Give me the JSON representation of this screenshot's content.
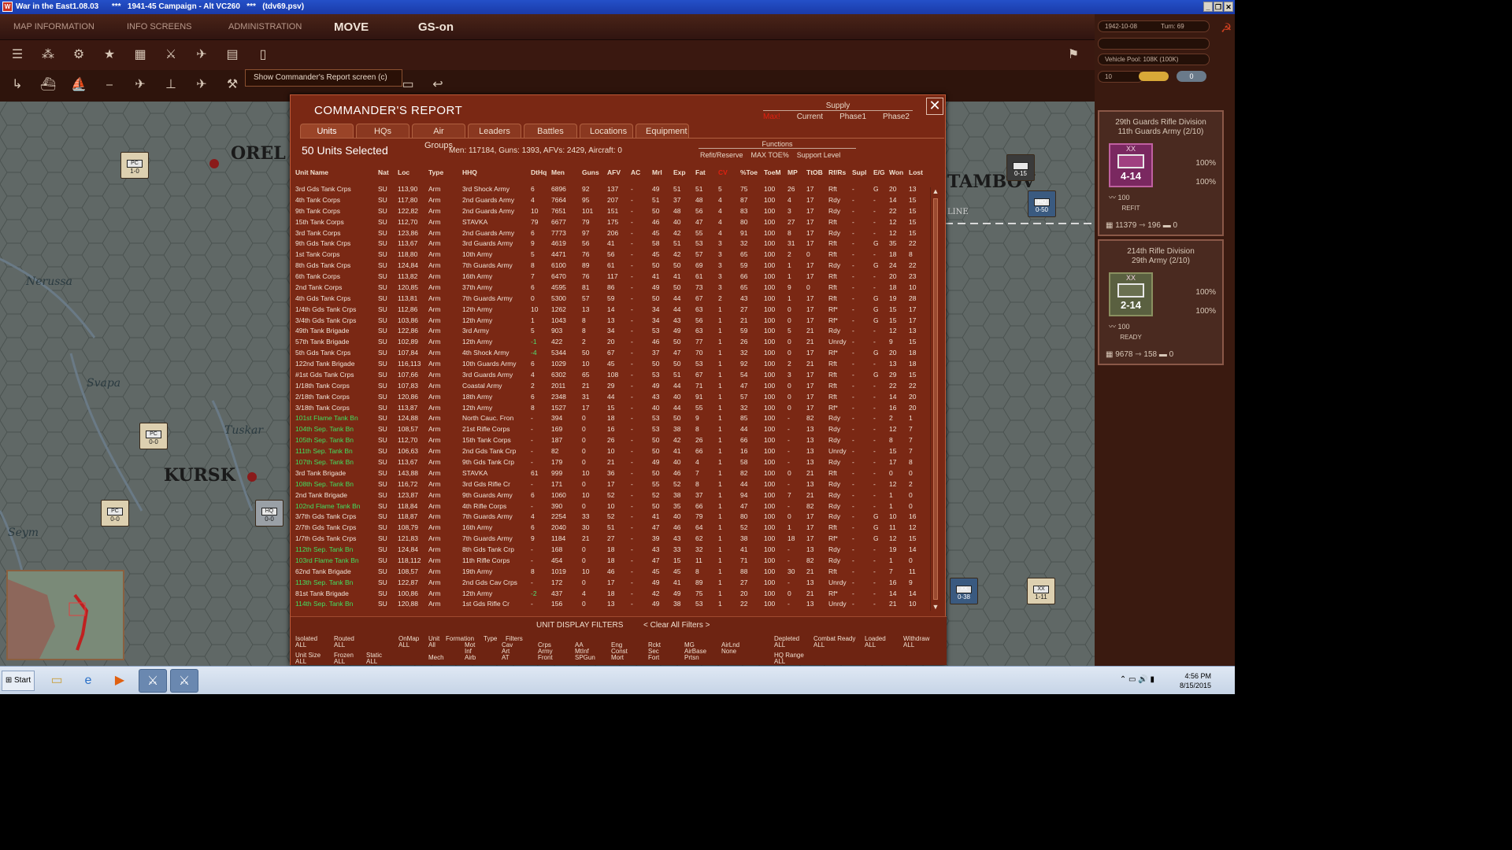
{
  "window": {
    "title": "War in the East1.08.03      ***   1941-45 Campaign - Alt VC260   ***   (tdv69.psv)"
  },
  "menu": {
    "map_information": "MAP INFORMATION",
    "info_screens": "INFO SCREENS",
    "administration": "ADMINISTRATION",
    "move": "MOVE",
    "gs": "GS-on"
  },
  "tooltip": "Show Commander's Report screen (c)",
  "status": {
    "date": "1942-10-08",
    "turn": "Turn: 69",
    "vehicle_pool": "Vehicle Pool: 108K (100K)",
    "count": "10",
    "zero": "0"
  },
  "map": {
    "city1": "OREL",
    "city2": "KURSK",
    "city3": "TAMBOV",
    "river1": "Nerussa",
    "river2": "Seym",
    "river3": "Tuskar",
    "river4": "Svapa",
    "line": "LINE"
  },
  "counters": [
    {
      "type": "PC",
      "val": "1-0"
    },
    {
      "type": "PC",
      "val": "0-0"
    },
    {
      "type": "PC",
      "val": "0-0"
    },
    {
      "type": "HQ",
      "val": "0-0"
    },
    {
      "type": "HQ",
      "val": "0-50"
    },
    {
      "type": "XX",
      "val": "0-38"
    },
    {
      "type": "XX",
      "val": "1-11"
    },
    {
      "type": "",
      "val": "0-15"
    }
  ],
  "cards": [
    {
      "name": "29th Guards Rifle Division",
      "sub": "11th Guards Army (2/10)",
      "str": "4-14",
      "xx": "XX",
      "pct1": "100%",
      "pct2": "100%",
      "morale": "100",
      "status": "REFIT",
      "men": "11379",
      "guns": "196",
      "afv": "0"
    },
    {
      "name": "214th Rifle Division",
      "sub": "29th Army (2/10)",
      "str": "2-14",
      "xx": "XX",
      "pct1": "100%",
      "pct2": "100%",
      "morale": "100",
      "status": "READY",
      "men": "9678",
      "guns": "158",
      "afv": "0"
    }
  ],
  "report": {
    "title": "COMMANDER'S REPORT",
    "supply_label": "Supply",
    "supply_opts": [
      "Max!",
      "Current",
      "Phase1",
      "Phase2"
    ],
    "tabs": [
      "Units",
      "HQs",
      "Air Groups",
      "Leaders",
      "Battles",
      "Locations",
      "Equipment"
    ],
    "selected": "50 Units Selected",
    "totals": "Men: 117184, Guns: 1393, AFVs: 2429, Aircraft: 0",
    "functions_label": "Functions",
    "functions": [
      "Refit/Reserve",
      "MAX TOE%",
      "Support Level"
    ],
    "columns": [
      "Unit Name",
      "Nat",
      "Loc",
      "Type",
      "HHQ",
      "DtHq",
      "Men",
      "Guns",
      "AFV",
      "AC",
      "Mrl",
      "Exp",
      "Fat",
      "CV",
      "%Toe",
      "ToeM",
      "MP",
      "TtOB",
      "Rf/Rs",
      "Supl",
      "E/G",
      "Won",
      "Lost"
    ],
    "rows": [
      [
        "3rd Gds Tank Crps",
        "SU",
        "113,90",
        "Arm",
        "3rd Shock Army",
        "6",
        "6896",
        "92",
        "137",
        "-",
        "49",
        "51",
        "51",
        "5",
        "75",
        "100",
        "26",
        "17",
        "Rft",
        "-",
        "G",
        "20",
        "13"
      ],
      [
        "4th Tank Corps",
        "SU",
        "117,80",
        "Arm",
        "2nd Guards Army",
        "4",
        "7664",
        "95",
        "207",
        "-",
        "51",
        "37",
        "48",
        "4",
        "87",
        "100",
        "4",
        "17",
        "Rdy",
        "-",
        "-",
        "14",
        "15"
      ],
      [
        "9th Tank Corps",
        "SU",
        "122,82",
        "Arm",
        "2nd Guards Army",
        "10",
        "7651",
        "101",
        "151",
        "-",
        "50",
        "48",
        "56",
        "4",
        "83",
        "100",
        "3",
        "17",
        "Rdy",
        "-",
        "-",
        "22",
        "15"
      ],
      [
        "15th Tank Corps",
        "SU",
        "112,70",
        "Arm",
        "STAVKA",
        "79",
        "6677",
        "79",
        "175",
        "-",
        "46",
        "40",
        "47",
        "4",
        "80",
        "100",
        "27",
        "17",
        "Rft",
        "-",
        "-",
        "12",
        "15"
      ],
      [
        "3rd Tank Corps",
        "SU",
        "123,86",
        "Arm",
        "2nd Guards Army",
        "6",
        "7773",
        "97",
        "206",
        "-",
        "45",
        "42",
        "55",
        "4",
        "91",
        "100",
        "8",
        "17",
        "Rdy",
        "-",
        "-",
        "12",
        "15"
      ],
      [
        "9th Gds Tank Crps",
        "SU",
        "113,67",
        "Arm",
        "3rd Guards Army",
        "9",
        "4619",
        "56",
        "41",
        "-",
        "58",
        "51",
        "53",
        "3",
        "32",
        "100",
        "31",
        "17",
        "Rft",
        "-",
        "G",
        "35",
        "22"
      ],
      [
        "1st Tank Corps",
        "SU",
        "118,80",
        "Arm",
        "10th Army",
        "5",
        "4471",
        "76",
        "56",
        "-",
        "45",
        "42",
        "57",
        "3",
        "65",
        "100",
        "2",
        "0",
        "Rft",
        "-",
        "-",
        "18",
        "8"
      ],
      [
        "8th Gds Tank Crps",
        "SU",
        "124,84",
        "Arm",
        "7th Guards Army",
        "8",
        "6100",
        "89",
        "61",
        "-",
        "50",
        "50",
        "69",
        "3",
        "59",
        "100",
        "1",
        "17",
        "Rdy",
        "-",
        "G",
        "24",
        "22"
      ],
      [
        "6th Tank Corps",
        "SU",
        "113,82",
        "Arm",
        "16th Army",
        "7",
        "6470",
        "76",
        "117",
        "-",
        "41",
        "41",
        "61",
        "3",
        "66",
        "100",
        "1",
        "17",
        "Rft",
        "-",
        "-",
        "20",
        "23"
      ],
      [
        "2nd Tank Corps",
        "SU",
        "120,85",
        "Arm",
        "37th Army",
        "6",
        "4595",
        "81",
        "86",
        "-",
        "49",
        "50",
        "73",
        "3",
        "65",
        "100",
        "9",
        "0",
        "Rft",
        "-",
        "-",
        "18",
        "10"
      ],
      [
        "4th Gds Tank Crps",
        "SU",
        "113,81",
        "Arm",
        "7th Guards Army",
        "0",
        "5300",
        "57",
        "59",
        "-",
        "50",
        "44",
        "67",
        "2",
        "43",
        "100",
        "1",
        "17",
        "Rft",
        "-",
        "G",
        "19",
        "28"
      ],
      [
        "1/4th Gds Tank Crps",
        "SU",
        "112,86",
        "Arm",
        "12th Army",
        "10",
        "1262",
        "13",
        "14",
        "-",
        "34",
        "44",
        "63",
        "1",
        "27",
        "100",
        "0",
        "17",
        "Rf*",
        "-",
        "G",
        "15",
        "17"
      ],
      [
        "3/4th Gds Tank Crps",
        "SU",
        "103,86",
        "Arm",
        "12th Army",
        "1",
        "1043",
        "8",
        "13",
        "-",
        "34",
        "43",
        "56",
        "1",
        "21",
        "100",
        "0",
        "17",
        "Rf*",
        "-",
        "G",
        "15",
        "17"
      ],
      [
        "49th Tank Brigade",
        "SU",
        "122,86",
        "Arm",
        "3rd Army",
        "5",
        "903",
        "8",
        "34",
        "-",
        "53",
        "49",
        "63",
        "1",
        "59",
        "100",
        "5",
        "21",
        "Rdy",
        "-",
        "-",
        "12",
        "13"
      ],
      [
        "57th Tank Brigade",
        "SU",
        "102,89",
        "Arm",
        "12th Army",
        "-1",
        "422",
        "2",
        "20",
        "-",
        "46",
        "50",
        "77",
        "1",
        "26",
        "100",
        "0",
        "21",
        "Unrdy",
        "-",
        "-",
        "9",
        "15"
      ],
      [
        "5th Gds Tank Crps",
        "SU",
        "107,84",
        "Arm",
        "4th Shock Army",
        "-4",
        "5344",
        "50",
        "67",
        "-",
        "37",
        "47",
        "70",
        "1",
        "32",
        "100",
        "0",
        "17",
        "Rf*",
        "-",
        "G",
        "20",
        "18"
      ],
      [
        "122nd Tank Brigade",
        "SU",
        "116,113",
        "Arm",
        "10th Guards Army",
        "6",
        "1029",
        "10",
        "45",
        "-",
        "50",
        "50",
        "53",
        "1",
        "92",
        "100",
        "2",
        "21",
        "Rft",
        "-",
        "-",
        "13",
        "18"
      ],
      [
        "#1st Gds Tank Crps",
        "SU",
        "107,66",
        "Arm",
        "3rd Guards Army",
        "4",
        "6302",
        "65",
        "108",
        "-",
        "53",
        "51",
        "67",
        "1",
        "54",
        "100",
        "3",
        "17",
        "Rft",
        "-",
        "G",
        "29",
        "15"
      ],
      [
        "1/18th Tank Corps",
        "SU",
        "107,83",
        "Arm",
        "Coastal Army",
        "2",
        "2011",
        "21",
        "29",
        "-",
        "49",
        "44",
        "71",
        "1",
        "47",
        "100",
        "0",
        "17",
        "Rft",
        "-",
        "-",
        "22",
        "22"
      ],
      [
        "2/18th Tank Corps",
        "SU",
        "120,86",
        "Arm",
        "18th Army",
        "6",
        "2348",
        "31",
        "44",
        "-",
        "43",
        "40",
        "91",
        "1",
        "57",
        "100",
        "0",
        "17",
        "Rft",
        "-",
        "-",
        "14",
        "20"
      ],
      [
        "3/18th Tank Corps",
        "SU",
        "113,87",
        "Arm",
        "12th Army",
        "8",
        "1527",
        "17",
        "15",
        "-",
        "40",
        "44",
        "55",
        "1",
        "32",
        "100",
        "0",
        "17",
        "Rf*",
        "-",
        "-",
        "16",
        "20"
      ],
      [
        "101st Flame Tank Bn",
        "SU",
        "124,88",
        "Arm",
        "North Cauc. Fron",
        "-",
        "394",
        "0",
        "18",
        "-",
        "53",
        "50",
        "9",
        "1",
        "85",
        "100",
        "-",
        "82",
        "Rdy",
        "-",
        "-",
        "2",
        "1"
      ],
      [
        "104th Sep. Tank Bn",
        "SU",
        "108,57",
        "Arm",
        "21st Rifle Corps",
        "-",
        "169",
        "0",
        "16",
        "-",
        "53",
        "38",
        "8",
        "1",
        "44",
        "100",
        "-",
        "13",
        "Rdy",
        "-",
        "-",
        "12",
        "7"
      ],
      [
        "105th Sep. Tank Bn",
        "SU",
        "112,70",
        "Arm",
        "15th Tank Corps",
        "-",
        "187",
        "0",
        "26",
        "-",
        "50",
        "42",
        "26",
        "1",
        "66",
        "100",
        "-",
        "13",
        "Rdy",
        "-",
        "-",
        "8",
        "7"
      ],
      [
        "111th Sep. Tank Bn",
        "SU",
        "106,63",
        "Arm",
        "2nd Gds Tank Crp",
        "-",
        "82",
        "0",
        "10",
        "-",
        "50",
        "41",
        "66",
        "1",
        "16",
        "100",
        "-",
        "13",
        "Unrdy",
        "-",
        "-",
        "15",
        "7"
      ],
      [
        "107th Sep. Tank Bn",
        "SU",
        "113,67",
        "Arm",
        "9th Gds Tank Crp",
        "-",
        "179",
        "0",
        "21",
        "-",
        "49",
        "40",
        "4",
        "1",
        "58",
        "100",
        "-",
        "13",
        "Rdy",
        "-",
        "-",
        "17",
        "8"
      ],
      [
        "3rd Tank Brigade",
        "SU",
        "143,88",
        "Arm",
        "STAVKA",
        "61",
        "999",
        "10",
        "36",
        "-",
        "50",
        "46",
        "7",
        "1",
        "82",
        "100",
        "0",
        "21",
        "Rft",
        "-",
        "-",
        "0",
        "0"
      ],
      [
        "108th Sep. Tank Bn",
        "SU",
        "116,72",
        "Arm",
        "3rd Gds Rifle Cr",
        "-",
        "171",
        "0",
        "17",
        "-",
        "55",
        "52",
        "8",
        "1",
        "44",
        "100",
        "-",
        "13",
        "Rdy",
        "-",
        "-",
        "12",
        "2"
      ],
      [
        "2nd Tank Brigade",
        "SU",
        "123,87",
        "Arm",
        "9th Guards Army",
        "6",
        "1060",
        "10",
        "52",
        "-",
        "52",
        "38",
        "37",
        "1",
        "94",
        "100",
        "7",
        "21",
        "Rdy",
        "-",
        "-",
        "1",
        "0"
      ],
      [
        "102nd Flame Tank Bn",
        "SU",
        "118,84",
        "Arm",
        "4th Rifle Corps",
        "-",
        "390",
        "0",
        "10",
        "-",
        "50",
        "35",
        "66",
        "1",
        "47",
        "100",
        "-",
        "82",
        "Rdy",
        "-",
        "-",
        "1",
        "0"
      ],
      [
        "3/7th Gds Tank Crps",
        "SU",
        "118,87",
        "Arm",
        "7th Guards Army",
        "4",
        "2254",
        "33",
        "52",
        "-",
        "41",
        "40",
        "79",
        "1",
        "80",
        "100",
        "0",
        "17",
        "Rdy",
        "-",
        "G",
        "10",
        "16"
      ],
      [
        "2/7th Gds Tank Crps",
        "SU",
        "108,79",
        "Arm",
        "16th Army",
        "6",
        "2040",
        "30",
        "51",
        "-",
        "47",
        "46",
        "64",
        "1",
        "52",
        "100",
        "1",
        "17",
        "Rft",
        "-",
        "G",
        "11",
        "12"
      ],
      [
        "1/7th Gds Tank Crps",
        "SU",
        "121,83",
        "Arm",
        "7th Guards Army",
        "9",
        "1184",
        "21",
        "27",
        "-",
        "39",
        "43",
        "62",
        "1",
        "38",
        "100",
        "18",
        "17",
        "Rf*",
        "-",
        "G",
        "12",
        "15"
      ],
      [
        "112th Sep. Tank Bn",
        "SU",
        "124,84",
        "Arm",
        "8th Gds Tank Crp",
        "-",
        "168",
        "0",
        "18",
        "-",
        "43",
        "33",
        "32",
        "1",
        "41",
        "100",
        "-",
        "13",
        "Rdy",
        "-",
        "-",
        "19",
        "14"
      ],
      [
        "103rd Flame Tank Bn",
        "SU",
        "118,112",
        "Arm",
        "11th Rifle Corps",
        "-",
        "454",
        "0",
        "18",
        "-",
        "47",
        "15",
        "11",
        "1",
        "71",
        "100",
        "-",
        "82",
        "Rdy",
        "-",
        "-",
        "1",
        "0"
      ],
      [
        "62nd Tank Brigade",
        "SU",
        "108,57",
        "Arm",
        "19th Army",
        "8",
        "1019",
        "10",
        "46",
        "-",
        "45",
        "45",
        "8",
        "1",
        "88",
        "100",
        "30",
        "21",
        "Rft",
        "-",
        "-",
        "7",
        "11"
      ],
      [
        "113th Sep. Tank Bn",
        "SU",
        "122,87",
        "Arm",
        "2nd Gds Cav Crps",
        "-",
        "172",
        "0",
        "17",
        "-",
        "49",
        "41",
        "89",
        "1",
        "27",
        "100",
        "-",
        "13",
        "Unrdy",
        "-",
        "-",
        "16",
        "9"
      ],
      [
        "81st Tank Brigade",
        "SU",
        "100,86",
        "Arm",
        "12th Army",
        "-2",
        "437",
        "4",
        "18",
        "-",
        "42",
        "49",
        "75",
        "1",
        "20",
        "100",
        "0",
        "21",
        "Rf*",
        "-",
        "-",
        "14",
        "14"
      ],
      [
        "114th Sep. Tank Bn",
        "SU",
        "120,88",
        "Arm",
        "1st Gds Rifle Cr",
        "-",
        "156",
        "0",
        "13",
        "-",
        "49",
        "38",
        "53",
        "1",
        "22",
        "100",
        "-",
        "13",
        "Unrdy",
        "-",
        "-",
        "21",
        "10"
      ]
    ],
    "green_rows": [
      21,
      22,
      23,
      24,
      25,
      27,
      29,
      33,
      34,
      36,
      38
    ],
    "filters": {
      "title": "UNIT DISPLAY FILTERS",
      "clear": "< Clear All Filters >",
      "groups": [
        {
          "label": "Isolated",
          "val": "ALL"
        },
        {
          "label": "Routed",
          "val": "ALL"
        },
        {
          "label": "OnMap",
          "val": "ALL"
        },
        {
          "label": "Unit",
          "val": "All"
        },
        {
          "label": "Unit Size",
          "val": "ALL"
        },
        {
          "label": "Frozen",
          "val": "ALL"
        },
        {
          "label": "Static",
          "val": "ALL"
        },
        {
          "label": "Formation",
          "val": ""
        },
        {
          "label": "Type",
          "val": ""
        },
        {
          "label": "Filters",
          "val": ""
        },
        {
          "label": "Depleted",
          "val": "ALL"
        },
        {
          "label": "Combat Ready",
          "val": "ALL"
        },
        {
          "label": "Loaded",
          "val": "ALL"
        },
        {
          "label": "Withdraw",
          "val": "ALL"
        },
        {
          "label": "HQ Range",
          "val": "ALL"
        }
      ],
      "types": [
        "Mech",
        "Mot",
        "Inf",
        "Airb",
        "Cav",
        "Art",
        "AT",
        "Crps",
        "Army",
        "Front",
        "AA",
        "MtInf",
        "SPGun",
        "Eng",
        "Const",
        "Mort",
        "Rckt",
        "Sec",
        "Fort",
        "MG",
        "AirBase",
        "Prtsn",
        "AirLnd",
        "None"
      ]
    }
  },
  "taskbar": {
    "start": "Start",
    "time": "4:56 PM",
    "date": "8/15/2015"
  }
}
